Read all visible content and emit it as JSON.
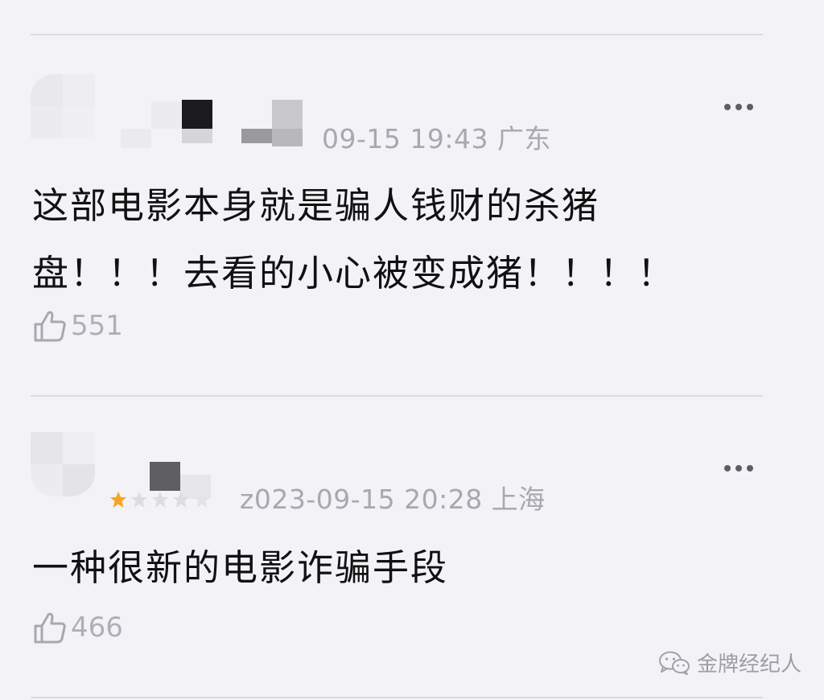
{
  "comments": [
    {
      "meta": "09-15 19:43 广东",
      "content_lines": [
        "这部电影本身就是骗人钱财的杀猪",
        "盘！！！去看的小心被变成猪！！！！"
      ],
      "likes": "551"
    },
    {
      "meta": "z023-09-15 20:28 上海",
      "content_lines": [
        "一种很新的电影诈骗手段"
      ],
      "likes": "466"
    }
  ],
  "watermark": {
    "label": "金牌经纪人"
  },
  "colors": {
    "background": "#f3f2f7",
    "text": "#111111",
    "meta": "#a9a8ae",
    "star": "#f5a623"
  },
  "icons": [
    "more-icon",
    "thumbs-up-icon",
    "star-icon",
    "wechat-icon"
  ]
}
